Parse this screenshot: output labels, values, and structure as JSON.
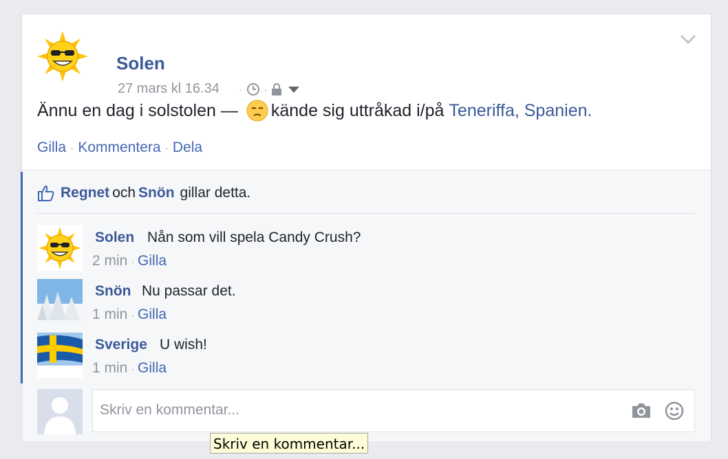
{
  "post": {
    "author": "Solen",
    "timestamp": "27 mars kl 16.34",
    "text_before": "Ännu en dag i solstolen —",
    "text_middle": "kände sig uttråkad i/på",
    "location": "Teneriffa, Spanien",
    "location_end": ".",
    "actions": {
      "like": "Gilla",
      "comment": "Kommentera",
      "share": "Dela"
    },
    "icons": {
      "clock": "clock-icon",
      "privacy": "lock-icon",
      "dropdown": "caret-down-icon",
      "menu": "chevron-down-icon",
      "feeling": "bored-face-emoji"
    }
  },
  "likes": {
    "user1": "Regnet",
    "joiner": "och",
    "user2": "Snön",
    "suffix": "gillar detta."
  },
  "comments": [
    {
      "author": "Solen",
      "text": "Nån som vill spela Candy Crush?",
      "time": "2 min",
      "like": "Gilla"
    },
    {
      "author": "Snön",
      "text": "Nu passar det.",
      "time": "1 min",
      "like": "Gilla"
    },
    {
      "author": "Sverige",
      "text": "U wish!",
      "time": "1 min",
      "like": "Gilla"
    }
  ],
  "composer": {
    "placeholder": "Skriv en kommentar...",
    "tooltip": "Skriv en kommentar..."
  },
  "colors": {
    "link": "#3b5998",
    "action": "#4267b2",
    "muted": "#90949c",
    "text": "#1d2129"
  }
}
